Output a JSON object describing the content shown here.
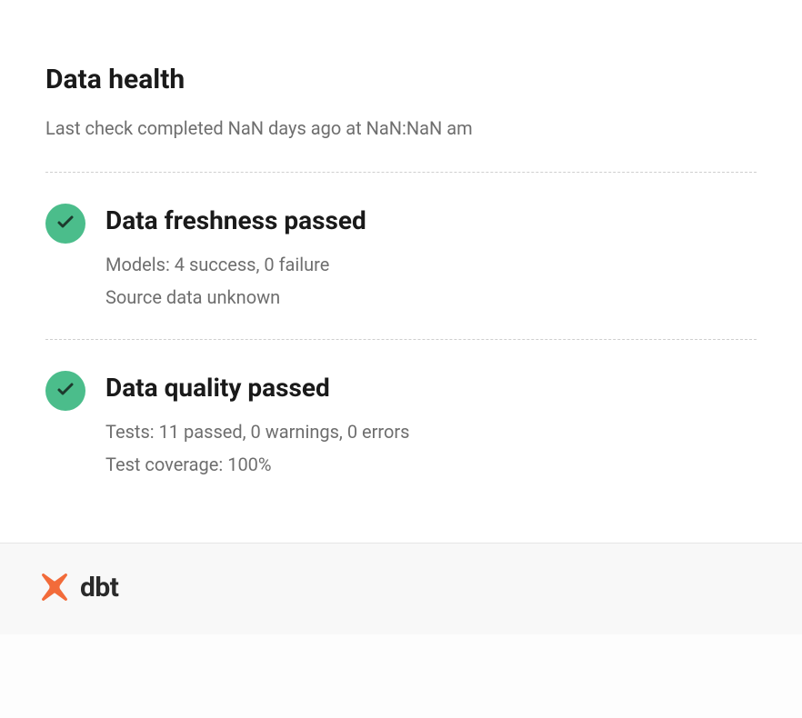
{
  "header": {
    "title": "Data health",
    "last_check": "Last check completed NaN days ago at NaN:NaN am"
  },
  "sections": [
    {
      "status": "passed",
      "title": "Data freshness passed",
      "details": [
        "Models: 4 success, 0 failure",
        "Source data unknown"
      ]
    },
    {
      "status": "passed",
      "title": "Data quality passed",
      "details": [
        "Tests: 11 passed, 0 warnings, 0 errors",
        "Test coverage: 100%"
      ]
    }
  ],
  "footer": {
    "brand": "dbt"
  }
}
